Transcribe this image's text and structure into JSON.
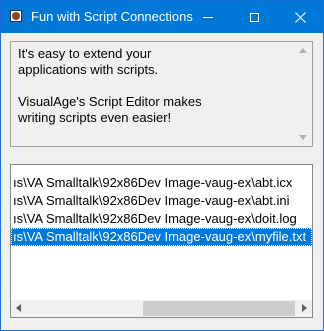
{
  "window": {
    "title": "Fun with Script Connections"
  },
  "description": {
    "text": "It's easy to extend your\napplications with scripts.\n\nVisualAge's Script Editor makes\nwriting scripts even easier!"
  },
  "file_list": {
    "items": [
      "ıs\\VA Smalltalk\\92x86Dev Image-vaug-ex\\abt.icx",
      "ıs\\VA Smalltalk\\92x86Dev Image-vaug-ex\\abt.ini",
      "ıs\\VA Smalltalk\\92x86Dev Image-vaug-ex\\doit.log",
      "ıs\\VA Smalltalk\\92x86Dev Image-vaug-ex\\myfile.txt"
    ],
    "selected_index": 3
  },
  "colors": {
    "titlebar": "#0078d7",
    "selection": "#0078d7"
  }
}
